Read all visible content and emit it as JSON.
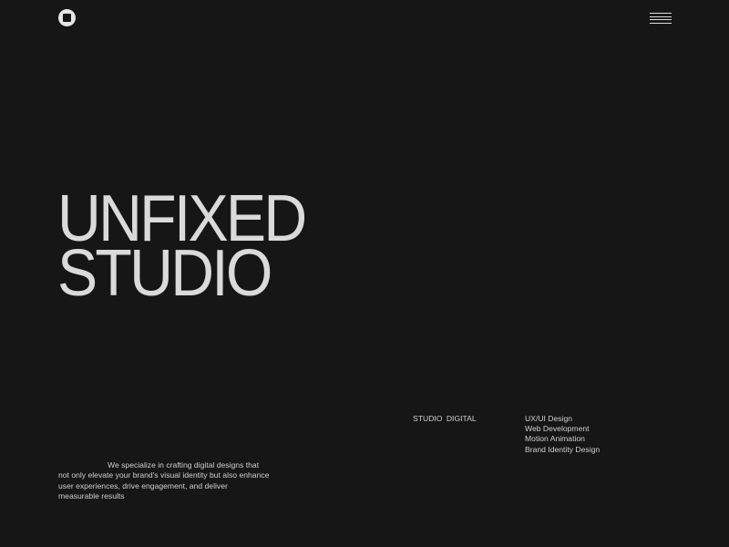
{
  "header": {
    "logo_icon": "circle-square-logo-icon",
    "menu_icon": "hamburger-menu-icon"
  },
  "hero": {
    "title_line1": "UNFIXED",
    "title_line2": "STUDIO"
  },
  "tagline": "We specialize in crafting digital designs that not only elevate your brand's visual identity but also enhance user experiences, drive engagement, and deliver measurable results",
  "studio_label": "STUDIO DIGITAL",
  "services": [
    "UX/UI Design",
    "Web Development",
    "Motion Animation",
    "Brand Identity Design"
  ],
  "colors": {
    "background": "#161616",
    "text": "#dadada"
  }
}
